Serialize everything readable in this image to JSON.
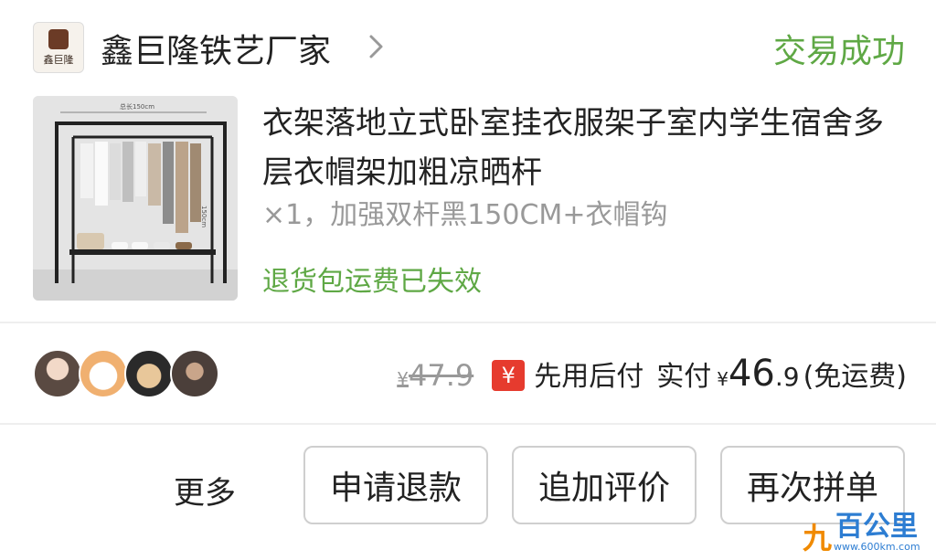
{
  "store": {
    "logo_text": "鑫巨隆",
    "name": "鑫巨隆铁艺厂家",
    "order_status": "交易成功"
  },
  "product": {
    "title": "衣架落地立式卧室挂衣服架子室内学生宿舍多层衣帽架加粗凉晒杆",
    "spec": "×1，加强双杆黑150CM+衣帽钩",
    "return_note": "退货包运费已失效",
    "image_labels": {
      "width_dim": "总长150cm",
      "height_dim": "150cm"
    }
  },
  "pricing": {
    "currency": "¥",
    "original_price": "47.9",
    "bnpl_badge": "¥",
    "bnpl_label": "先用后付",
    "paid_label": "实付",
    "paid_int": "46",
    "paid_dec": ".9",
    "shipping_note": "(免运费)"
  },
  "actions": {
    "more": "更多",
    "refund": "申请退款",
    "review": "追加评价",
    "reorder": "再次拼单"
  },
  "watermark": {
    "logo": "百公里",
    "mark": "九",
    "url": "www.600km.com"
  },
  "colors": {
    "success_green": "#5fa845",
    "badge_red": "#e63b2e",
    "watermark_blue": "#2d7dd2"
  }
}
